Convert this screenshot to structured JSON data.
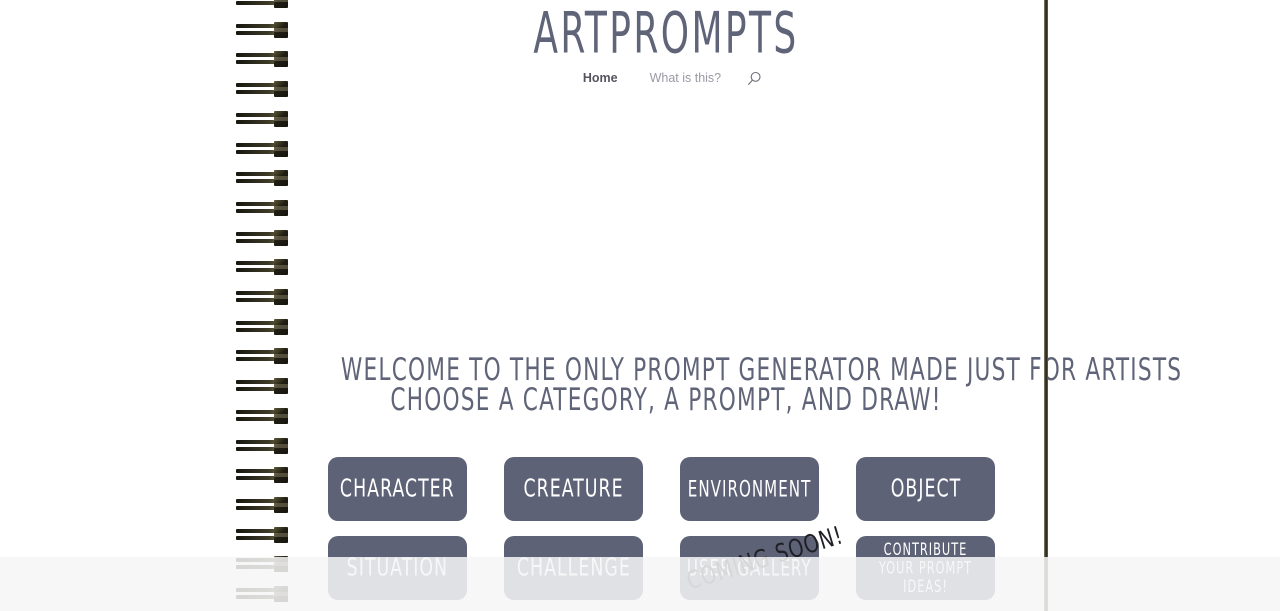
{
  "site": {
    "title": "ARTPROMPTS"
  },
  "nav": {
    "items": [
      {
        "label": "Home",
        "active": true
      },
      {
        "label": "What is this?",
        "active": false
      }
    ],
    "search_icon": "search-icon"
  },
  "headline": {
    "line1": "WELCOME TO THE ONLY PROMPT GENERATOR MADE JUST FOR ARTISTS",
    "line2": "CHOOSE A CATEGORY, A PROMPT, AND DRAW!"
  },
  "categories": {
    "row1": [
      {
        "label": "CHARACTER",
        "badge": ""
      },
      {
        "label": "CREATURE",
        "badge": ""
      },
      {
        "label": "ENVIRONMENT",
        "badge": ""
      },
      {
        "label": "OBJECT",
        "badge": ""
      }
    ],
    "row2": [
      {
        "label": "SITUATION",
        "badge": ""
      },
      {
        "label": "CHALLENGE",
        "badge": ""
      },
      {
        "label": "USER GALLERY",
        "badge": "COMING SOON!"
      },
      {
        "label": "CONTRIBUTE YOUR PROMPT IDEAS!",
        "badge": ""
      }
    ]
  },
  "colors": {
    "button": "#5e6277",
    "text_slate": "#5f6478",
    "nav_inactive": "#9a9aa4",
    "nav_active": "#55555f",
    "page_bg": "#ffffff",
    "veil": "#f6f6f6",
    "spiral": "#2b2a1c"
  }
}
